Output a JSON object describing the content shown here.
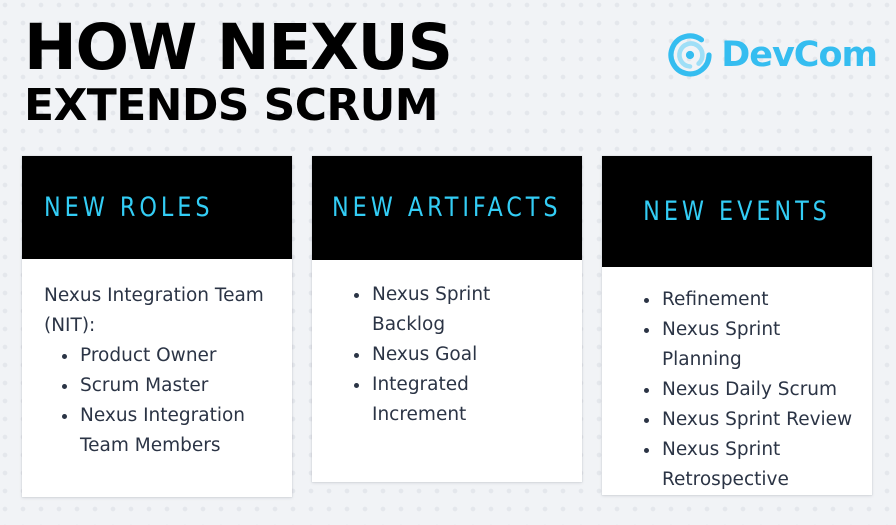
{
  "slide": {
    "title_line1": "HOW NEXUS",
    "title_line2": "EXTENDS SCRUM",
    "background_color": "#f1f3f6",
    "dot_color": "#e4e7ec"
  },
  "logo": {
    "name": "DevCom",
    "mark_icon": "devcom-concentric-circle-icon",
    "color": "#35bdf0"
  },
  "cards": [
    {
      "heading": "NEW ROLES",
      "heading_color": "#33cdf5",
      "header_background": "#000000",
      "intro": "Nexus Integration Team (NIT):",
      "items": [
        "Product Owner",
        "Scrum Master",
        "Nexus Integration Team Members"
      ]
    },
    {
      "heading": "NEW ARTIFACTS",
      "heading_color": "#33cdf5",
      "header_background": "#000000",
      "intro": "",
      "items": [
        "Nexus Sprint Backlog",
        "Nexus Goal",
        "Integrated Increment"
      ]
    },
    {
      "heading": "NEW EVENTS",
      "heading_color": "#33cdf5",
      "header_background": "#000000",
      "intro": "",
      "items": [
        "Refinement",
        "Nexus Sprint Planning",
        "Nexus Daily Scrum",
        "Nexus Sprint Review",
        "Nexus Sprint Retrospective"
      ]
    }
  ]
}
